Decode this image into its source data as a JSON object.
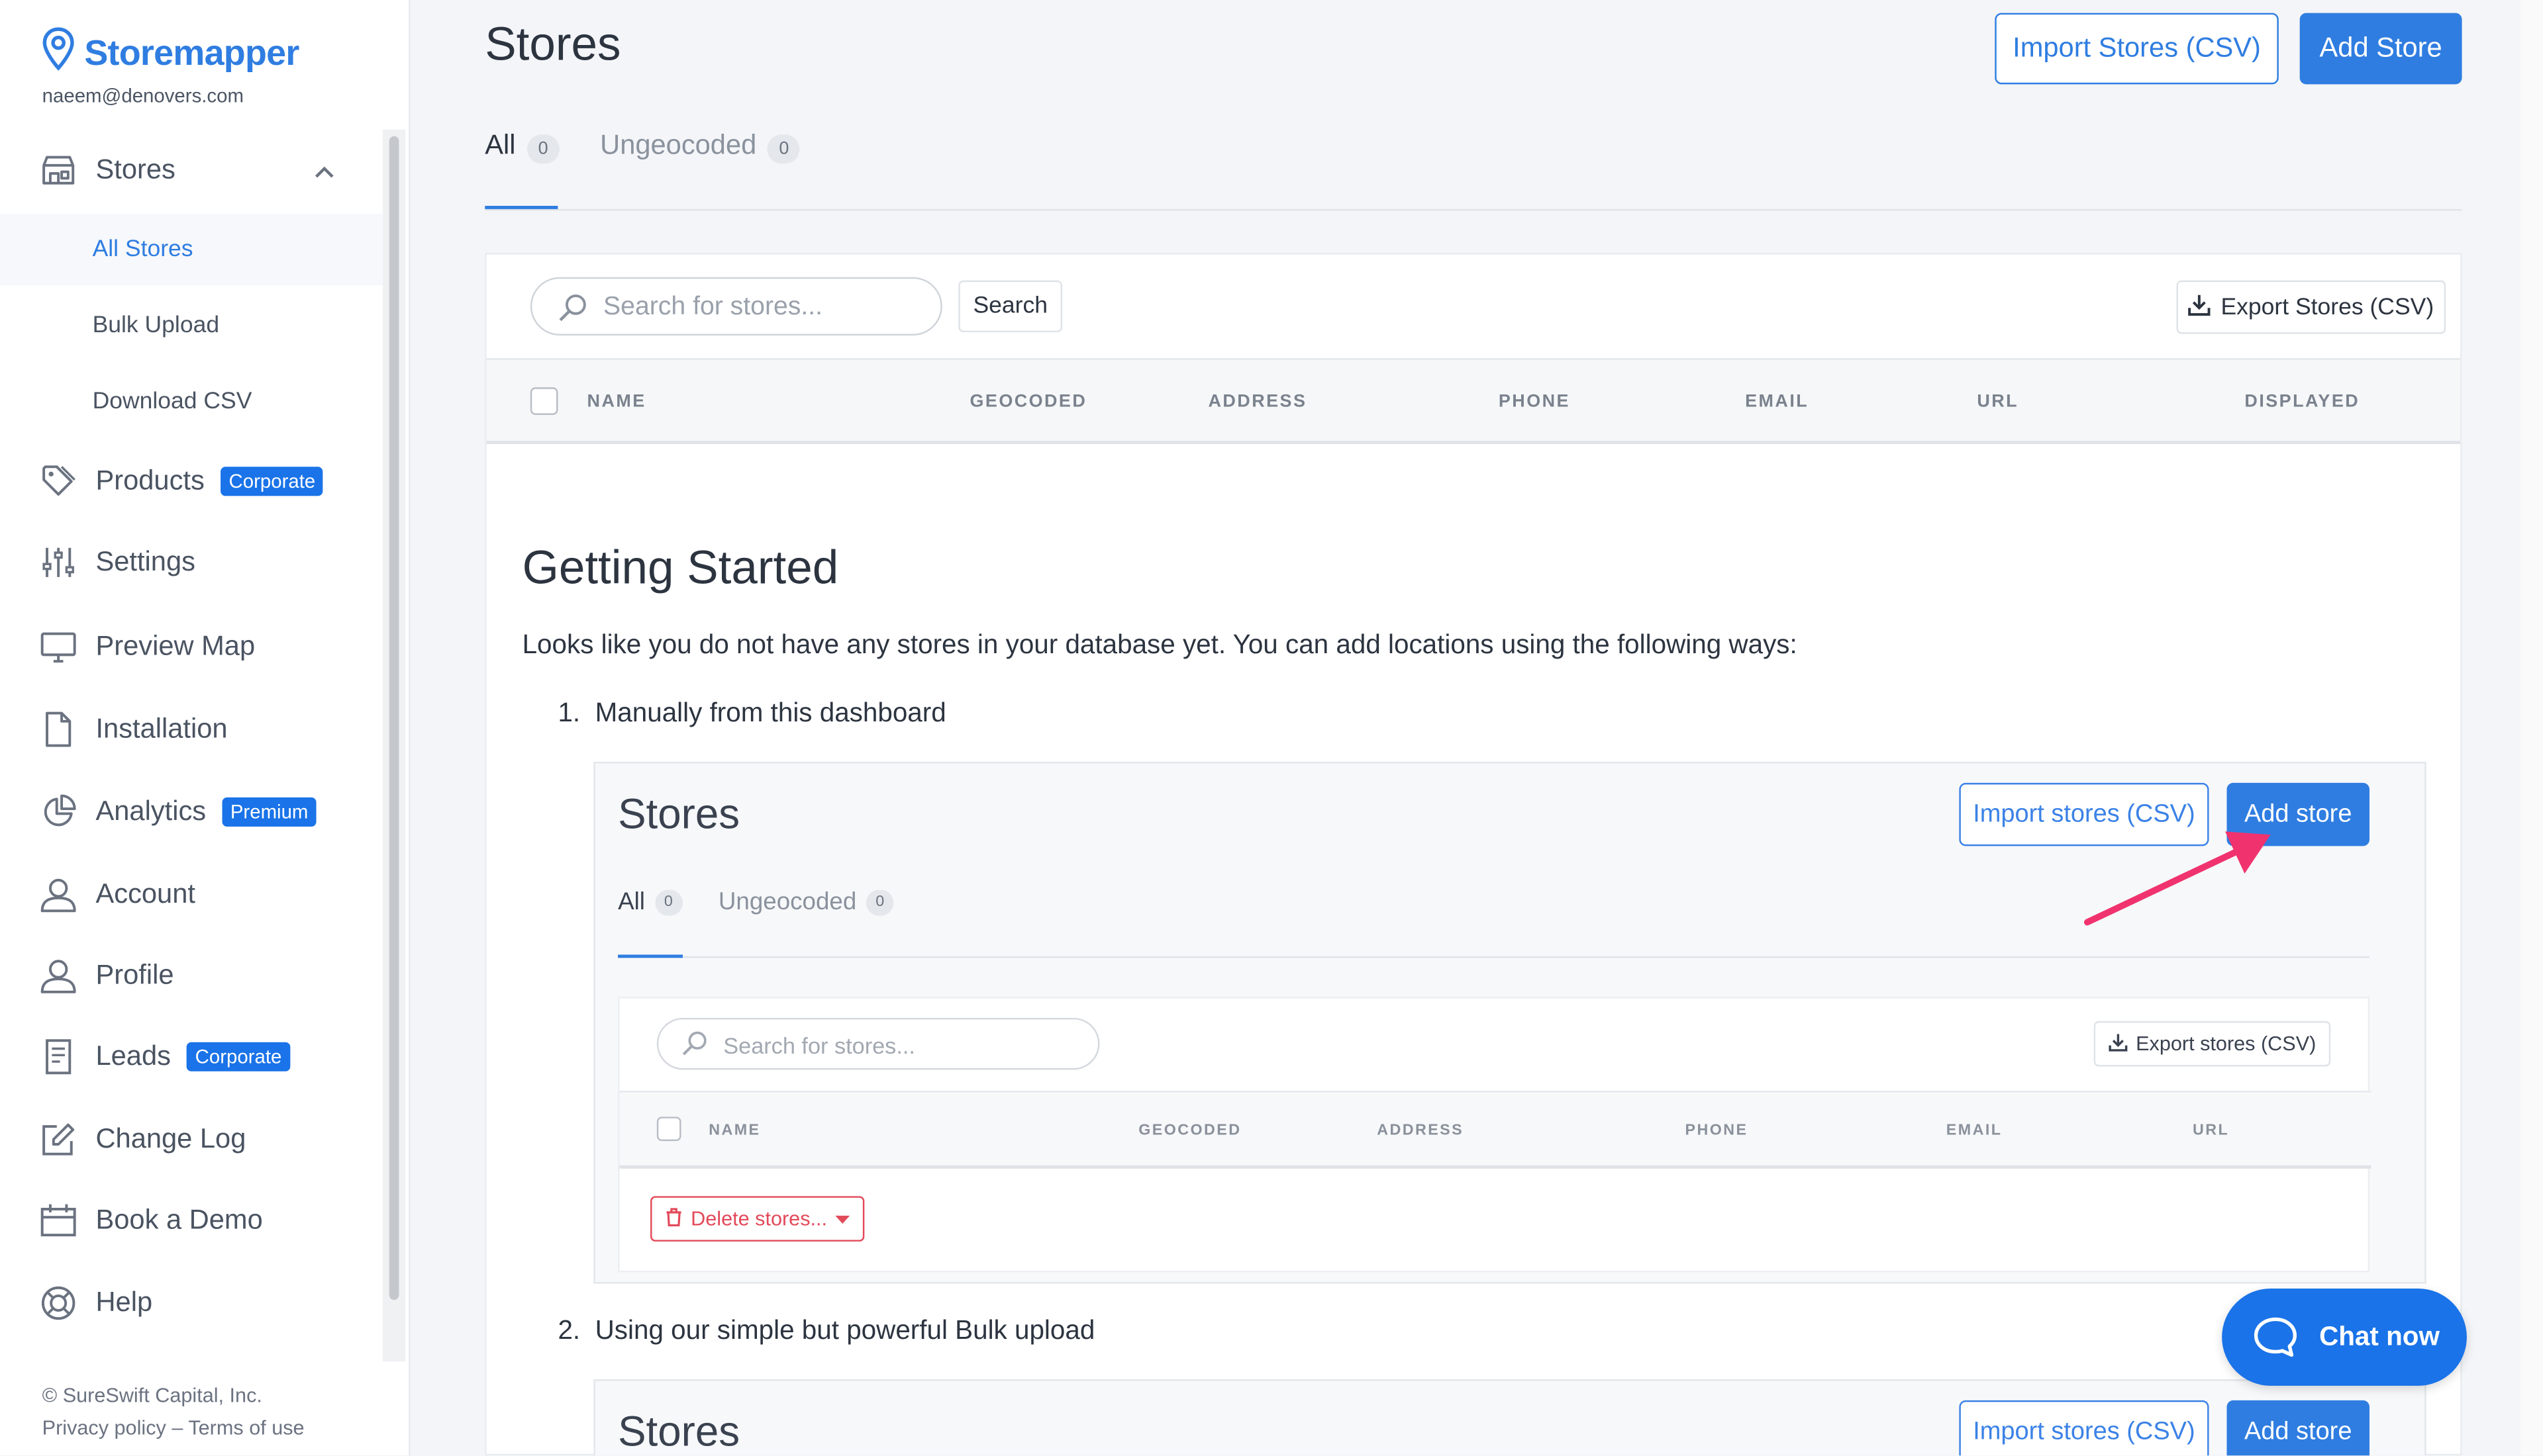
{
  "brand": {
    "name": "Storemapper",
    "email": "naeem@denovers.com",
    "accent": "#2f7de1"
  },
  "sidebar": {
    "stores": {
      "label": "Stores",
      "icon": "store-icon"
    },
    "sub_items": [
      {
        "label": "All Stores",
        "active": true
      },
      {
        "label": "Bulk Upload"
      },
      {
        "label": "Download CSV"
      }
    ],
    "items": [
      {
        "label": "Products",
        "icon": "tag-icon",
        "badge": "Corporate"
      },
      {
        "label": "Settings",
        "icon": "sliders-icon"
      },
      {
        "label": "Preview Map",
        "icon": "monitor-icon"
      },
      {
        "label": "Installation",
        "icon": "file-icon"
      },
      {
        "label": "Analytics",
        "icon": "pie-chart-icon",
        "badge": "Premium"
      },
      {
        "label": "Account",
        "icon": "user-icon"
      },
      {
        "label": "Profile",
        "icon": "user-icon"
      },
      {
        "label": "Leads",
        "icon": "document-icon",
        "badge": "Corporate"
      },
      {
        "label": "Change Log",
        "icon": "edit-icon"
      },
      {
        "label": "Book a Demo",
        "icon": "calendar-icon"
      },
      {
        "label": "Help",
        "icon": "lifebuoy-icon"
      }
    ],
    "footer": {
      "copyright": "© SureSwift Capital, Inc.",
      "privacy": "Privacy policy",
      "sep": "–",
      "terms": "Terms of use"
    }
  },
  "header": {
    "title": "Stores",
    "import_label": "Import Stores (CSV)",
    "add_label": "Add Store"
  },
  "tabs": [
    {
      "label": "All",
      "count": "0",
      "active": true
    },
    {
      "label": "Ungeocoded",
      "count": "0"
    }
  ],
  "toolbar": {
    "search_placeholder": "Search for stores...",
    "search_label": "Search",
    "export_label": "Export Stores (CSV)"
  },
  "table": {
    "columns": [
      "NAME",
      "GEOCODED",
      "ADDRESS",
      "PHONE",
      "EMAIL",
      "URL",
      "DISPLAYED"
    ]
  },
  "getting_started": {
    "title": "Getting Started",
    "description": "Looks like you do not have any stores in your database yet. You can add locations using the following ways:",
    "steps": [
      {
        "num": "1.",
        "text": "Manually from this dashboard"
      },
      {
        "num": "2.",
        "text": "Using our simple but powerful Bulk upload"
      }
    ]
  },
  "example_screenshot": {
    "title": "Stores",
    "import_label": "Import stores (CSV)",
    "add_label": "Add store",
    "tabs": [
      {
        "label": "All",
        "count": "0"
      },
      {
        "label": "Ungeocoded",
        "count": "0"
      }
    ],
    "search_placeholder": "Search for stores...",
    "export_label": "Export stores (CSV)",
    "columns": [
      "NAME",
      "GEOCODED",
      "ADDRESS",
      "PHONE",
      "EMAIL",
      "URL"
    ],
    "delete_label": "Delete stores...",
    "arrow_color": "#f0336e"
  },
  "chat": {
    "label": "Chat now",
    "color": "#1a73e8"
  }
}
